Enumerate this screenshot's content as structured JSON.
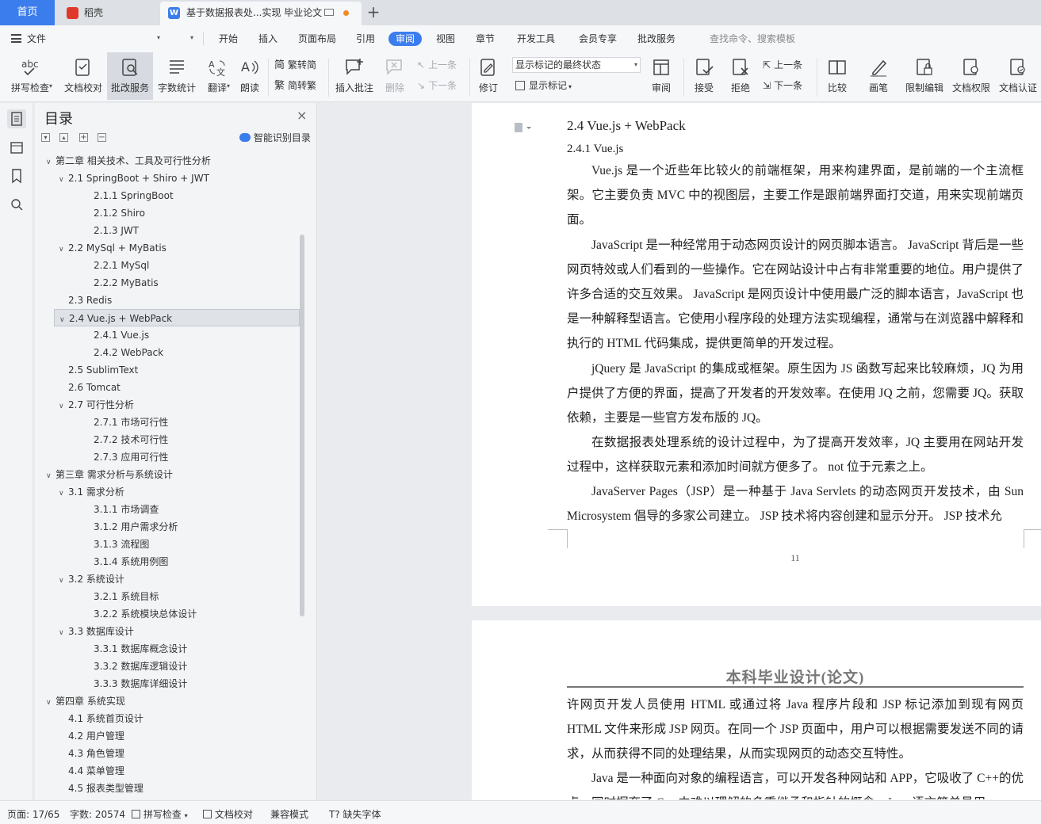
{
  "tabs": {
    "home": "首页",
    "wk": "稻壳",
    "doc": "基于数据报表处...实现 毕业论文"
  },
  "menu": {
    "file": "文件",
    "items": [
      "开始",
      "插入",
      "页面布局",
      "引用",
      "审阅",
      "视图",
      "章节",
      "开发工具",
      "会员专享",
      "批改服务"
    ],
    "active": "审阅",
    "search_placeholder": "查找命令、搜索模板"
  },
  "ribbon": {
    "spellcheck": "拼写检查",
    "proofread": "文档校对",
    "review_service": "批改服务",
    "word_count": "字数统计",
    "translate": "翻译",
    "read_aloud": "朗读",
    "trad": "繁转简",
    "simp": "简转繁",
    "insert_comment": "插入批注",
    "delete": "删除",
    "prev": "上一条",
    "next": "下一条",
    "track": "修订",
    "markup_select": "显示标记的最终状态",
    "show_markup": "显示标记",
    "review": "审阅",
    "accept": "接受",
    "reject": "拒绝",
    "prev2": "上一条",
    "next2": "下一条",
    "compare": "比较",
    "ink": "画笔",
    "restrict": "限制编辑",
    "permission": "文档权限",
    "certify": "文档认证"
  },
  "toc": {
    "title": "目录",
    "smart": "智能识别目录",
    "items": [
      {
        "text": "第二章 相关技术、工具及可行性分析",
        "level": 1,
        "arrow": true
      },
      {
        "text": "2.1 SpringBoot + Shiro + JWT",
        "level": 2,
        "arrow": true
      },
      {
        "text": "2.1.1 SpringBoot",
        "level": 3,
        "arrow": false
      },
      {
        "text": "2.1.2 Shiro",
        "level": 3,
        "arrow": false
      },
      {
        "text": "2.1.3 JWT",
        "level": 3,
        "arrow": false
      },
      {
        "text": "2.2 MySql + MyBatis",
        "level": 2,
        "arrow": true
      },
      {
        "text": "2.2.1 MySql",
        "level": 3,
        "arrow": false
      },
      {
        "text": "2.2.2 MyBatis",
        "level": 3,
        "arrow": false
      },
      {
        "text": "2.3 Redis",
        "level": 2,
        "arrow": false
      },
      {
        "text": "2.4 Vue.js + WebPack",
        "level": 2,
        "arrow": true,
        "selected": true
      },
      {
        "text": "2.4.1 Vue.js",
        "level": 3,
        "arrow": false
      },
      {
        "text": "2.4.2 WebPack",
        "level": 3,
        "arrow": false
      },
      {
        "text": "2.5 SublimText",
        "level": 2,
        "arrow": false
      },
      {
        "text": "2.6 Tomcat",
        "level": 2,
        "arrow": false
      },
      {
        "text": "2.7  可行性分析",
        "level": 2,
        "arrow": true
      },
      {
        "text": "2.7.1  市场可行性",
        "level": 3,
        "arrow": false
      },
      {
        "text": "2.7.2  技术可行性",
        "level": 3,
        "arrow": false
      },
      {
        "text": "2.7.3  应用可行性",
        "level": 3,
        "arrow": false
      },
      {
        "text": "第三章  需求分析与系统设计",
        "level": 1,
        "arrow": true
      },
      {
        "text": "3.1  需求分析",
        "level": 2,
        "arrow": true
      },
      {
        "text": "3.1.1 市场调查",
        "level": 3,
        "arrow": false
      },
      {
        "text": "3.1.2  用户需求分析",
        "level": 3,
        "arrow": false
      },
      {
        "text": "3.1.3  流程图",
        "level": 3,
        "arrow": false
      },
      {
        "text": "3.1.4  系统用例图",
        "level": 3,
        "arrow": false
      },
      {
        "text": "3.2  系统设计",
        "level": 2,
        "arrow": true
      },
      {
        "text": "3.2.1  系统目标",
        "level": 3,
        "arrow": false
      },
      {
        "text": "3.2.2  系统模块总体设计",
        "level": 3,
        "arrow": false
      },
      {
        "text": "3.3  数据库设计",
        "level": 2,
        "arrow": true
      },
      {
        "text": "3.3.1  数据库概念设计",
        "level": 3,
        "arrow": false
      },
      {
        "text": "3.3.2  数据库逻辑设计",
        "level": 3,
        "arrow": false
      },
      {
        "text": "3.3.3 数据库详细设计",
        "level": 3,
        "arrow": false
      },
      {
        "text": "第四章  系统实现",
        "level": 1,
        "arrow": true
      },
      {
        "text": "4.1  系统首页设计",
        "level": 2,
        "arrow": false
      },
      {
        "text": "4.2  用户管理",
        "level": 2,
        "arrow": false
      },
      {
        "text": "4.3  角色管理",
        "level": 2,
        "arrow": false
      },
      {
        "text": "4.4  菜单管理",
        "level": 2,
        "arrow": false
      },
      {
        "text": "4.5  报表类型管理",
        "level": 2,
        "arrow": false
      }
    ]
  },
  "document": {
    "heading": "2.4 Vue.js + WebPack",
    "subheading": "2.4.1 Vue.js",
    "paragraphs": [
      "Vue.js 是一个近些年比较火的前端框架，用来构建界面，是前端的一个主流框架。它主要负责 MVC 中的视图层，主要工作是跟前端界面打交道，用来实现前端页面。",
      "JavaScript 是一种经常用于动态网页设计的网页脚本语言。 JavaScript 背后是一些网页特效或人们看到的一些操作。它在网站设计中占有非常重要的地位。用户提供了许多合适的交互效果。 JavaScript 是网页设计中使用最广泛的脚本语言，JavaScript 也是一种解释型语言。它使用小程序段的处理方法实现编程，通常与在浏览器中解释和执行的 HTML  代码集成，提供更简单的开发过程。",
      "jQuery 是 JavaScript 的集成或框架。原生因为 JS 函数写起来比较麻烦，JQ 为用户提供了方便的界面，提高了开发者的开发效率。在使用 JQ 之前，您需要 JQ。获取依赖，主要是一些官方发布版的 JQ。",
      "在数据报表处理系统的设计过程中，为了提高开发效率，JQ 主要用在网站开发过程中，这样获取元素和添加时间就方便多了。 not 位于元素之上。",
      "JavaServer Pages（JSP）是一种基于 Java Servlets 的动态网页开发技术，由 Sun Microsystem 倡导的多家公司建立。 JSP 技术将内容创建和显示分开。 JSP 技术允"
    ],
    "page_number": "11",
    "header_title": "本科毕业设计(论文)",
    "page2_paragraphs": [
      "许网页开发人员使用 HTML 或通过将 Java 程序片段和 JSP 标记添加到现有网页 HTML 文件来形成 JSP 网页。在同一个 JSP 页面中，用户可以根据需要发送不同的请求，从而获得不同的处理结果，从而实现网页的动态交互特性。",
      "Java 是一种面向对象的编程语言，可以开发各种网站和 APP，它吸收了 C++的优点，同时摒弃了 C++中难以理解的多重继承和指针的概念。Java 语言简单易用"
    ]
  },
  "status": {
    "page": "页面: 17/65",
    "words": "字数: 20574",
    "spell": "拼写检查",
    "proof": "文档校对",
    "compat": "兼容模式",
    "missing_font": "缺失字体"
  },
  "colors": {
    "accent": "#3b7ded",
    "wps_red": "#e0392b"
  }
}
